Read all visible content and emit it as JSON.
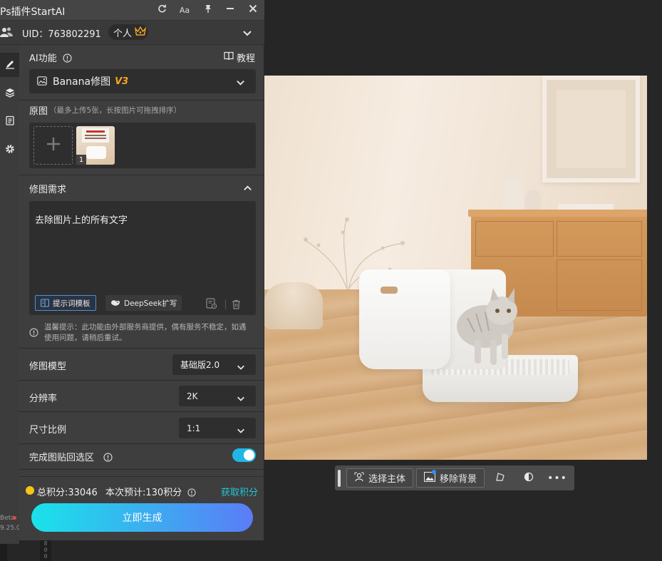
{
  "window": {
    "title": "Ps插件StartAI",
    "buttons": [
      "refresh",
      "font-size",
      "pin",
      "minimize",
      "close"
    ],
    "font_button_label": "Aa"
  },
  "user": {
    "uid_label": "UID：763802291",
    "plan_label": "个人"
  },
  "ai_function": {
    "label": "AI功能",
    "tutorial_label": "教程",
    "selected_tool": "Banana修图",
    "tool_version": "V3"
  },
  "source_image": {
    "label": "原图",
    "hint": "（最多上传5张，长按图片可拖拽排序）",
    "thumbnails": [
      {
        "index": "1"
      }
    ]
  },
  "edit_request": {
    "label": "修图需求",
    "prompt_text": "去除图片上的所有文字",
    "template_button": "提示词模板",
    "deepseek_button": "DeepSeek扩写",
    "notice": "温馨提示：此功能由外部服务商提供，偶有服务不稳定，如遇使用问题，请稍后重试。"
  },
  "settings": {
    "model_label": "修图模型",
    "model_value": "基础版2.0",
    "resolution_label": "分辨率",
    "resolution_value": "2K",
    "ratio_label": "尺寸比例",
    "ratio_value": "1:1",
    "paste_back_label": "完成图贴回选区",
    "paste_back_on": true
  },
  "footer": {
    "credits_text": "总积分:33046",
    "estimate_text": "本次预计:130积分",
    "get_credits_link": "获取积分",
    "generate_button": "立即生成"
  },
  "rail": {
    "version_line1": "Beta",
    "version_line2": "9.25.0"
  },
  "canvas_toolbar": {
    "select_subject": "选择主体",
    "remove_background": "移除背景"
  },
  "ruler": {
    "marks": [
      "8",
      "0",
      "0"
    ]
  },
  "colors": {
    "accent_orange": "#f5a623",
    "link_cyan": "#22c5d8",
    "toggle_on": "#1fb8e6",
    "generate_gradient_start": "#19e3ea",
    "generate_gradient_end": "#5b7cf6",
    "panel_bg": "#3e3e3e",
    "field_bg": "#2e2e2e"
  },
  "icons": [
    "refresh-icon",
    "font-size-icon",
    "pin-icon",
    "minimize-icon",
    "close-icon",
    "users-icon",
    "crown-icon",
    "chevron-down-icon",
    "info-icon",
    "book-icon",
    "image-icon",
    "plus-icon",
    "chevron-up-icon",
    "template-icon",
    "deepseek-icon",
    "history-icon",
    "trash-icon",
    "coin-icon",
    "pencil-icon",
    "layers-icon",
    "clipboard-icon",
    "gear-icon",
    "person-select-icon",
    "remove-bg-icon",
    "crop-transform-icon",
    "contrast-icon",
    "more-icon"
  ]
}
